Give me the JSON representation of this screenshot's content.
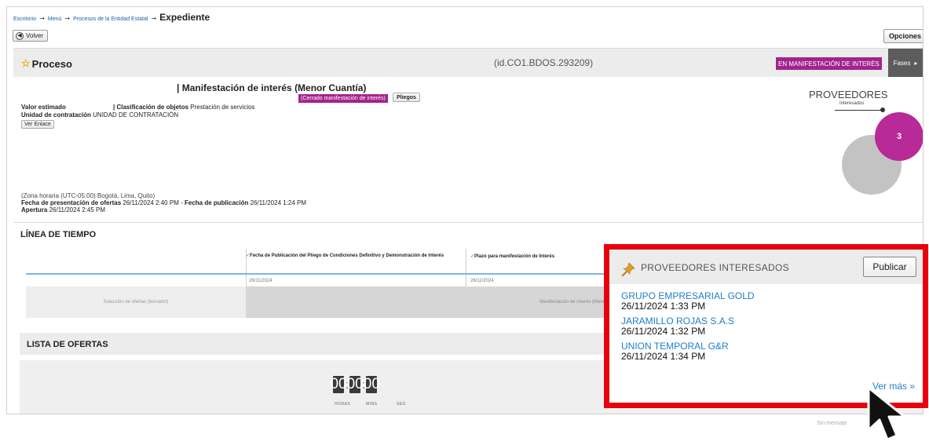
{
  "breadcrumb": {
    "items": [
      "Escritorio",
      "Menú",
      "Procesos de la Entidad Estatal"
    ],
    "separator": "➞",
    "current": "Expediente"
  },
  "toolbar": {
    "back_label": "Volver",
    "options_label": "Opciones",
    "options_chevron": "▾"
  },
  "process": {
    "title": "Proceso",
    "id_text": "(id.CO1.BDOS.293209)",
    "status_badge": "EN MANIFESTACIÓN DE INTERÉS",
    "phases_label": "Fases",
    "phases_arrow": "▸"
  },
  "details": {
    "modality": "| Manifestación de interés (Menor Cuantía)",
    "state_badge": "(Cerrado manifestación de interés)",
    "pliegos_label": "Pliegos",
    "estimated_value_label": "Valor estimado",
    "classification_label": "| Clasificación de objetos",
    "classification_value": "Prestación de servicios",
    "unit_label": "Unidad de contratación",
    "unit_value": "UNIDAD DE CONTRATACIÓN",
    "link_label": "Ver Enlace",
    "timezone": "(Zona horaria (UTC-05:00) Bogotá, Lima, Quito)",
    "offers_date_label": "Fecha de presentación de ofertas",
    "offers_date_value": "26/11/2024 2:40 PM",
    "dash": " - ",
    "publication_date_label": "Fecha de publicación",
    "publication_date_value": "26/11/2024 1:24 PM",
    "opening_label": "Apertura",
    "opening_value": "26/11/2024 2:45 PM"
  },
  "providers_summary": {
    "title": "PROVEEDORES",
    "subtitle": "Interesados",
    "count": "3",
    "colors": {
      "bubble_main": "#b72a97",
      "bubble_bg": "#c3c3c3"
    }
  },
  "timeline": {
    "heading": "LÍNEA DE TIEMPO",
    "columns": [
      {
        "header": "Fecha de Publicación del Pliego de Condiciones Definitivo y Demonstración de Interés",
        "date": "26/11/2024"
      },
      {
        "header": "Plazo para manifestación de Interés",
        "date": "26/11/2024"
      }
    ],
    "phases": [
      "Selección de ofertas (borrador)",
      "Manifestación de interés (Menor C"
    ]
  },
  "offers": {
    "heading": "LISTA DE OFERTAS",
    "countdown": {
      "hours": "00",
      "mins": "00",
      "secs": "00"
    },
    "countdown_labels": {
      "hours": "HORAS",
      "mins": "MINS",
      "secs": "SEG"
    },
    "bg_hint": "Sin mensaje"
  },
  "interested": {
    "title": "PROVEEDORES INTERESADOS",
    "publish_label": "Publicar",
    "providers": [
      {
        "name": "GRUPO EMPRESARIAL GOLD",
        "date": "26/11/2024 1:33 PM"
      },
      {
        "name": "JARAMILLO ROJAS S.A.S",
        "date": "26/11/2024 1:32 PM"
      },
      {
        "name": "UNION TEMPORAL G&R",
        "date": "26/11/2024 1:34 PM"
      }
    ],
    "see_more": "Ver más »",
    "highlight_color": "#e8000d"
  },
  "colors": {
    "brand_magenta": "#a3238e",
    "link_blue": "#1f7fc9",
    "header_gray": "#ececec",
    "fases_dark": "#5c5c5c"
  }
}
